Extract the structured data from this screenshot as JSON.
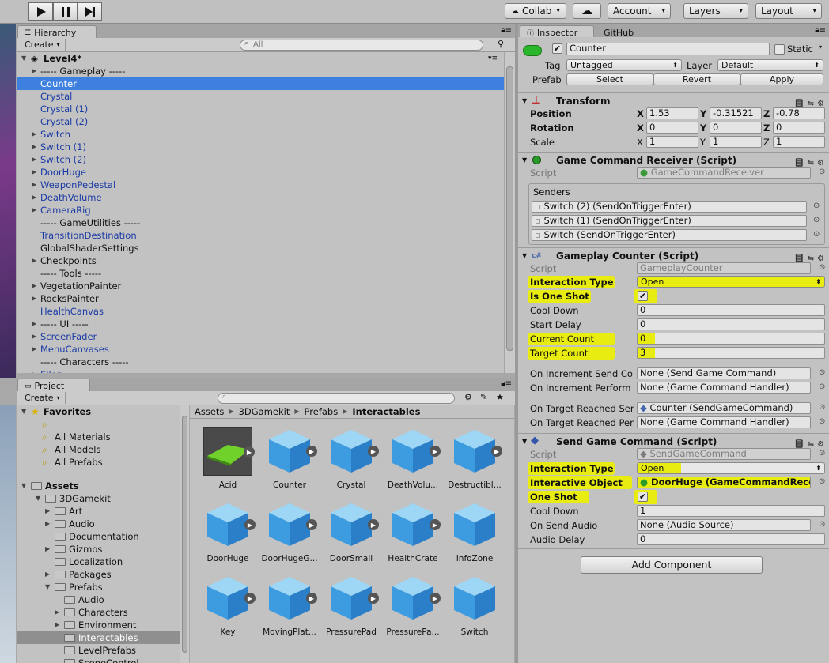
{
  "toolbar": {
    "collab": "Collab",
    "account": "Account",
    "layers": "Layers",
    "layout": "Layout"
  },
  "hierarchy": {
    "tab": "Hierarchy",
    "create": "Create",
    "search_placeholder": "All",
    "scene": "Level4*",
    "items": [
      {
        "label": "----- Gameplay -----",
        "arrow": true,
        "blue": false,
        "indent": 0
      },
      {
        "label": "Counter",
        "arrow": false,
        "blue": true,
        "indent": 0,
        "selected": true
      },
      {
        "label": "Crystal",
        "arrow": false,
        "blue": true,
        "indent": 0
      },
      {
        "label": "Crystal (1)",
        "arrow": false,
        "blue": true,
        "indent": 0
      },
      {
        "label": "Crystal (2)",
        "arrow": false,
        "blue": true,
        "indent": 0
      },
      {
        "label": "Switch",
        "arrow": true,
        "blue": true,
        "indent": 0
      },
      {
        "label": "Switch (1)",
        "arrow": true,
        "blue": true,
        "indent": 0
      },
      {
        "label": "Switch (2)",
        "arrow": true,
        "blue": true,
        "indent": 0
      },
      {
        "label": "DoorHuge",
        "arrow": true,
        "blue": true,
        "indent": 0
      },
      {
        "label": "WeaponPedestal",
        "arrow": true,
        "blue": true,
        "indent": 0
      },
      {
        "label": "DeathVolume",
        "arrow": true,
        "blue": true,
        "indent": 0
      },
      {
        "label": "CameraRig",
        "arrow": true,
        "blue": true,
        "indent": 0
      },
      {
        "label": "----- GameUtilities -----",
        "arrow": false,
        "blue": false,
        "indent": 0
      },
      {
        "label": "TransitionDestination",
        "arrow": false,
        "blue": true,
        "indent": 0
      },
      {
        "label": "GlobalShaderSettings",
        "arrow": false,
        "blue": false,
        "indent": 0
      },
      {
        "label": "Checkpoints",
        "arrow": true,
        "blue": false,
        "indent": 0
      },
      {
        "label": "----- Tools -----",
        "arrow": false,
        "blue": false,
        "indent": 0
      },
      {
        "label": "VegetationPainter",
        "arrow": true,
        "blue": false,
        "indent": 0
      },
      {
        "label": "RocksPainter",
        "arrow": true,
        "blue": false,
        "indent": 0
      },
      {
        "label": "HealthCanvas",
        "arrow": false,
        "blue": true,
        "indent": 0
      },
      {
        "label": "----- UI -----",
        "arrow": true,
        "blue": false,
        "indent": 0
      },
      {
        "label": "ScreenFader",
        "arrow": true,
        "blue": true,
        "indent": 0
      },
      {
        "label": "MenuCanvases",
        "arrow": true,
        "blue": true,
        "indent": 0
      },
      {
        "label": "----- Characters -----",
        "arrow": false,
        "blue": false,
        "indent": 0
      },
      {
        "label": "Ellen",
        "arrow": true,
        "blue": true,
        "indent": 0
      }
    ]
  },
  "project": {
    "tab": "Project",
    "create": "Create",
    "favorites_label": "Favorites",
    "favorites": [
      "All Materials",
      "All Models",
      "All Prefabs"
    ],
    "assets_label": "Assets",
    "tree": [
      {
        "label": "3DGamekit",
        "level": 1,
        "arrow": "down"
      },
      {
        "label": "Art",
        "level": 2,
        "arrow": "right"
      },
      {
        "label": "Audio",
        "level": 2,
        "arrow": "right"
      },
      {
        "label": "Documentation",
        "level": 2,
        "arrow": ""
      },
      {
        "label": "Gizmos",
        "level": 2,
        "arrow": "right"
      },
      {
        "label": "Localization",
        "level": 2,
        "arrow": ""
      },
      {
        "label": "Packages",
        "level": 2,
        "arrow": "right"
      },
      {
        "label": "Prefabs",
        "level": 2,
        "arrow": "down"
      },
      {
        "label": "Audio",
        "level": 3,
        "arrow": ""
      },
      {
        "label": "Characters",
        "level": 3,
        "arrow": "right"
      },
      {
        "label": "Environment",
        "level": 3,
        "arrow": "right"
      },
      {
        "label": "Interactables",
        "level": 3,
        "arrow": "",
        "selected": true
      },
      {
        "label": "LevelPrefabs",
        "level": 3,
        "arrow": ""
      },
      {
        "label": "SceneControl",
        "level": 3,
        "arrow": ""
      }
    ],
    "breadcrumb": [
      "Assets",
      "3DGamekit",
      "Prefabs",
      "Interactables"
    ],
    "assets": [
      "Acid",
      "Counter",
      "Crystal",
      "DeathVolu...",
      "Destructibl...",
      "DoorHuge",
      "DoorHugeG...",
      "DoorSmall",
      "HealthCrate",
      "InfoZone",
      "Key",
      "MovingPlat...",
      "PressurePad",
      "PressurePa...",
      "Switch"
    ]
  },
  "inspector": {
    "tab": "Inspector",
    "tab2": "GitHub",
    "object_name": "Counter",
    "static_label": "Static",
    "tag_label": "Tag",
    "tag_value": "Untagged",
    "layer_label": "Layer",
    "layer_value": "Default",
    "prefab_label": "Prefab",
    "prefab_select": "Select",
    "prefab_revert": "Revert",
    "prefab_apply": "Apply",
    "transform": {
      "title": "Transform",
      "position_label": "Position",
      "rotation_label": "Rotation",
      "scale_label": "Scale",
      "position": [
        "1.53",
        "-0.31521",
        "-0.78"
      ],
      "rotation": [
        "0",
        "0",
        "0"
      ],
      "scale": [
        "1",
        "1",
        "1"
      ]
    },
    "receiver": {
      "title": "Game Command Receiver (Script)",
      "script_label": "Script",
      "script_value": "GameCommandReceiver",
      "senders_label": "Senders",
      "senders": [
        "Switch (2) (SendOnTriggerEnter)",
        "Switch (1) (SendOnTriggerEnter)",
        "Switch (SendOnTriggerEnter)"
      ]
    },
    "counter": {
      "title": "Gameplay Counter (Script)",
      "script_label": "Script",
      "script_value": "GameplayCounter",
      "interaction_type_label": "Interaction Type",
      "interaction_type_value": "Open",
      "is_one_shot_label": "Is One Shot",
      "cool_down_label": "Cool Down",
      "cool_down_value": "0",
      "start_delay_label": "Start Delay",
      "start_delay_value": "0",
      "current_count_label": "Current Count",
      "current_count_value": "0",
      "target_count_label": "Target Count",
      "target_count_value": "3",
      "on_inc_send_label": "On Increment Send Co",
      "on_inc_send_value": "None (Send Game Command)",
      "on_inc_perform_label": "On Increment Perform",
      "on_inc_perform_value": "None (Game Command Handler)",
      "on_target_send_label": "On Target Reached Ser",
      "on_target_send_value": "Counter (SendGameCommand)",
      "on_target_perform_label": "On Target Reached Per",
      "on_target_perform_value": "None (Game Command Handler)"
    },
    "send": {
      "title": "Send Game Command (Script)",
      "script_label": "Script",
      "script_value": "SendGameCommand",
      "interaction_type_label": "Interaction Type",
      "interaction_type_value": "Open",
      "interactive_object_label": "Interactive Object",
      "interactive_object_value": "DoorHuge (GameCommandRece",
      "one_shot_label": "One Shot",
      "cool_down_label": "Cool Down",
      "cool_down_value": "1",
      "on_send_audio_label": "On Send Audio",
      "on_send_audio_value": "None (Audio Source)",
      "audio_delay_label": "Audio Delay",
      "audio_delay_value": "0"
    },
    "add_component": "Add Component"
  },
  "colors": {
    "selection": "#3d80df",
    "highlight": "#e8ec10",
    "prefab_blue": "#1a3aa5"
  }
}
